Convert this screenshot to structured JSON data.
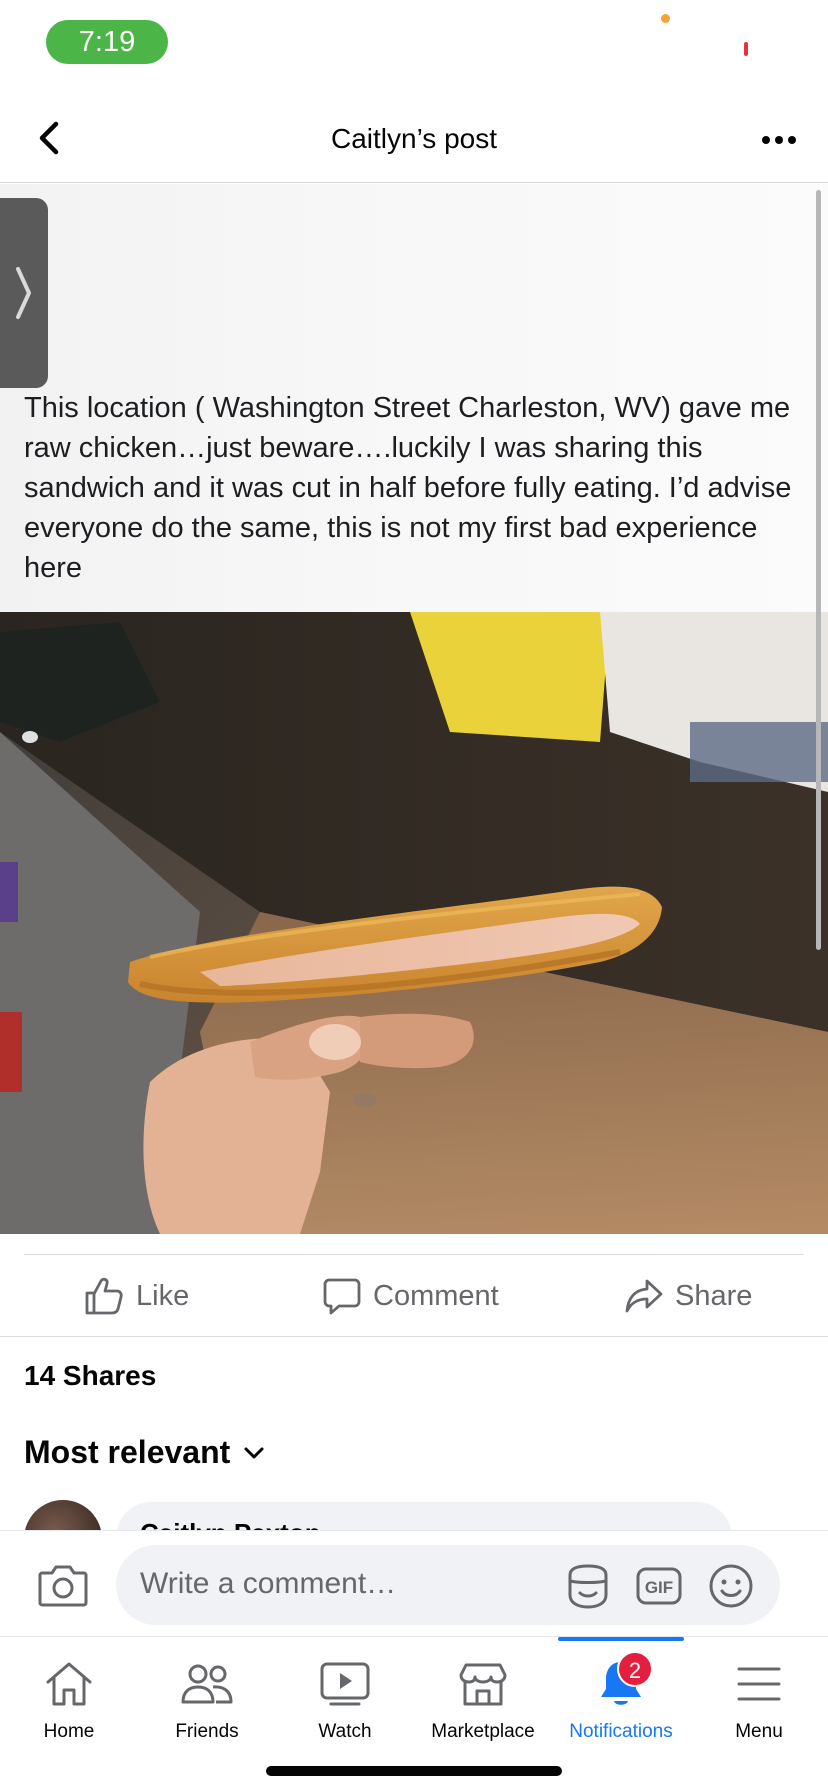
{
  "status_bar": {
    "time": "7:19"
  },
  "header": {
    "title": "Caitlyn’s post"
  },
  "post": {
    "text": "This location ( Washington Street Charleston, WV) gave me raw chicken…just beware….luckily I was sharing this sandwich and it was cut in half before fully eating. I’d advise everyone do the same, this is not my first bad experience here",
    "photo_icon": "photo-raw-chicken-sandwich"
  },
  "actions": {
    "like": "Like",
    "comment": "Comment",
    "share": "Share"
  },
  "stats": {
    "shares": "14 Shares"
  },
  "comments": {
    "sort_label": "Most relevant",
    "peek_name": "Caitlyn Paxton"
  },
  "composer": {
    "placeholder": "Write a comment…",
    "gif_label": "GIF"
  },
  "tabs": [
    {
      "label": "Home",
      "icon": "home-icon"
    },
    {
      "label": "Friends",
      "icon": "friends-icon"
    },
    {
      "label": "Watch",
      "icon": "watch-icon"
    },
    {
      "label": "Marketplace",
      "icon": "marketplace-icon"
    },
    {
      "label": "Notifications",
      "icon": "bell-icon",
      "badge": "2",
      "active": true
    },
    {
      "label": "Menu",
      "icon": "menu-icon"
    }
  ],
  "colors": {
    "accent": "#1877f2",
    "badge": "#e41e3f",
    "time_pill": "#4cb548"
  }
}
